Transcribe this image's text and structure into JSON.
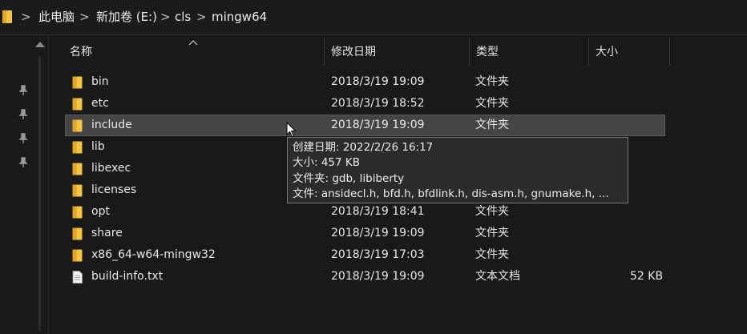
{
  "breadcrumb": {
    "items": [
      "此电脑",
      "新加卷 (E:)",
      "cls",
      "mingw64"
    ],
    "separator": ">"
  },
  "columns": {
    "name": "名称",
    "date": "修改日期",
    "type": "类型",
    "size": "大小"
  },
  "files": [
    {
      "name": "bin",
      "date": "2018/3/19 19:09",
      "type": "文件夹",
      "size": "",
      "icon": "folder-icon"
    },
    {
      "name": "etc",
      "date": "2018/3/19 18:52",
      "type": "文件夹",
      "size": "",
      "icon": "folder-icon"
    },
    {
      "name": "include",
      "date": "2018/3/19 19:09",
      "type": "文件夹",
      "size": "",
      "icon": "folder-icon"
    },
    {
      "name": "lib",
      "date": "",
      "type": "",
      "size": "",
      "icon": "folder-icon"
    },
    {
      "name": "libexec",
      "date": "",
      "type": "",
      "size": "",
      "icon": "folder-icon"
    },
    {
      "name": "licenses",
      "date": "",
      "type": "",
      "size": "",
      "icon": "folder-icon"
    },
    {
      "name": "opt",
      "date": "2018/3/19 18:41",
      "type": "文件夹",
      "size": "",
      "icon": "folder-icon"
    },
    {
      "name": "share",
      "date": "2018/3/19 19:09",
      "type": "文件夹",
      "size": "",
      "icon": "folder-icon"
    },
    {
      "name": "x86_64-w64-mingw32",
      "date": "2018/3/19 17:03",
      "type": "文件夹",
      "size": "",
      "icon": "folder-icon"
    },
    {
      "name": "build-info.txt",
      "date": "2018/3/19 19:09",
      "type": "文本文档",
      "size": "52 KB",
      "icon": "text-file-icon"
    }
  ],
  "tooltip": {
    "created": "创建日期: 2022/2/26 16:17",
    "size": "大小: 457 KB",
    "folders": "文件夹: gdb, libiberty",
    "files": "文件: ansidecl.h, bfd.h, bfdlink.h, dis-asm.h, gnumake.h, ..."
  },
  "colors": {
    "background": "#191919",
    "hover_row": "#454545",
    "folder": "#f4c542",
    "tooltip_bg": "#2b2b2b"
  },
  "icons": {
    "address_folder": "folder-icon",
    "pins": [
      "pin-icon",
      "pin-icon",
      "pin-icon",
      "pin-icon"
    ],
    "sort": "chevron-up-icon",
    "cursor": "mouse-cursor-icon"
  }
}
